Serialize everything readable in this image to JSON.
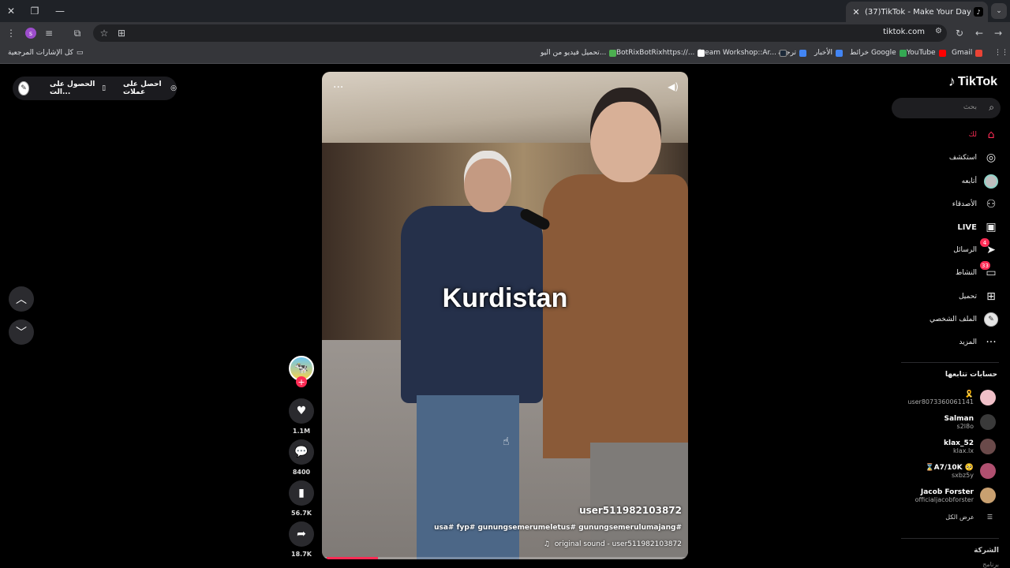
{
  "browser": {
    "tab_title": "(37)TikTok - Make Your Day",
    "tab_close": "✕",
    "new_tab": "+",
    "url": "tiktok.com",
    "profile_initial": "s",
    "window_controls": {
      "close": "✕",
      "restore": "❐",
      "minimize": "—"
    },
    "toolbar_icons": [
      "menu-icon",
      "profile-icon",
      "playlist-icon",
      "extensions-icon",
      "bookmark-star-icon",
      "translate-icon",
      "reload-icon",
      "back-icon",
      "forward-icon"
    ]
  },
  "bookmarks": {
    "all_bookmarks": "كل الإشارات المرجعية",
    "items": [
      {
        "label": "Gmail",
        "color": "#ea4335"
      },
      {
        "label": "YouTube",
        "color": "#ff0000"
      },
      {
        "label": "خرائط Google",
        "color": "#34a853"
      },
      {
        "label": "الأخبار",
        "color": "#4285f4"
      },
      {
        "label": "ترجمة",
        "color": "#4285f4"
      },
      {
        "label": "Steam Workshop::Ar...",
        "color": "#1b2838"
      },
      {
        "label": "BotRixBotRixhttps://...",
        "color": "#ffffff"
      },
      {
        "label": "تحميل فيديو من اليو...",
        "color": "#4caf50"
      }
    ]
  },
  "top_pill": {
    "get_coins": "احصل على عملات",
    "get_app": "الحصول على الت..."
  },
  "video": {
    "caption_overlay": "Kurdistan",
    "author": "user511982103872",
    "hashtags": "usa# fyp# gunungsemerumeletus# gunungsemerulumajang#",
    "sound": "original sound - user511982103872",
    "progress": 0.14
  },
  "actions": {
    "likes": "1.1M",
    "comments": "8400",
    "saves": "56.7K",
    "shares": "18.7K"
  },
  "sidebar": {
    "logo": "TikTok",
    "search_placeholder": "بحث",
    "nav": [
      {
        "label": "لك",
        "icon": "home-icon"
      },
      {
        "label": "استكشف",
        "icon": "compass-icon"
      },
      {
        "label": "أتابعه",
        "icon": "following-avatar-icon"
      },
      {
        "label": "الأصدقاء",
        "icon": "friends-icon"
      },
      {
        "label": "LIVE",
        "icon": "live-icon"
      },
      {
        "label": "الرسائل",
        "icon": "messages-icon",
        "badge": "4"
      },
      {
        "label": "النشاط",
        "icon": "activity-icon",
        "badge": "33"
      },
      {
        "label": "تحميل",
        "icon": "upload-icon"
      },
      {
        "label": "الملف الشخصي",
        "icon": "profile-icon"
      },
      {
        "label": "المزيد",
        "icon": "more-icon"
      }
    ],
    "following_title": "حسابات تتابعها",
    "following": [
      {
        "name": "🎗️",
        "handle": "user8073360061141",
        "color": "#f0c0c8"
      },
      {
        "name": "Salman",
        "handle": "s2l8o",
        "color": "#3a3a3a"
      },
      {
        "name": "klax_52",
        "handle": "klax.lx",
        "color": "#6a4a4a"
      },
      {
        "name": "⌛A7/10K 🥺",
        "handle": "sxbz5y",
        "color": "#b05070"
      },
      {
        "name": "Jacob Forster",
        "handle": "officialjacobforster",
        "color": "#c9a070"
      }
    ],
    "see_all": "عرض الكل",
    "company": "الشركة",
    "company_sub": "برنامج"
  }
}
